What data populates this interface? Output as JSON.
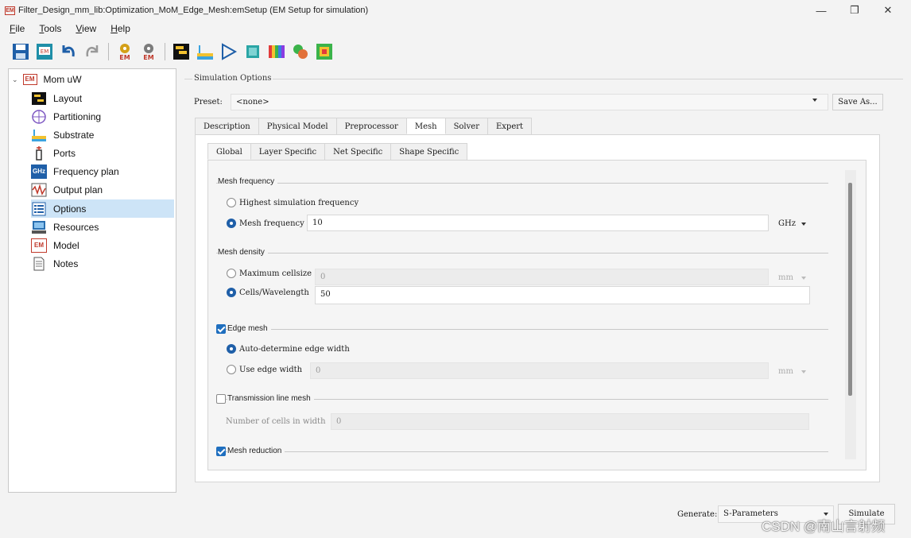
{
  "window": {
    "app_icon": "EM",
    "title": "Filter_Design_mm_lib:Optimization_MoM_Edge_Mesh:emSetup (EM Setup for simulation)",
    "controls": [
      "—",
      "❐",
      "✕"
    ]
  },
  "menu": [
    "File",
    "Tools",
    "View",
    "Help"
  ],
  "toolbar": {
    "icons": [
      "save-icon",
      "em-save-icon",
      "undo-icon",
      "redo-icon",
      "em-settings-icon",
      "em-settings-alt-icon",
      "layout-icon",
      "substrate-icon",
      "port-icon",
      "model-icon",
      "rainbow-icon",
      "component-icon",
      "mesh-plot-icon"
    ]
  },
  "tree": {
    "root": {
      "label": "Mom uW",
      "icon": "EM"
    },
    "items": [
      {
        "label": "Layout",
        "icon": "layout-icon"
      },
      {
        "label": "Partitioning",
        "icon": "partitioning-icon"
      },
      {
        "label": "Substrate",
        "icon": "substrate-icon"
      },
      {
        "label": "Ports",
        "icon": "ports-icon"
      },
      {
        "label": "Frequency plan",
        "icon": "ghz-icon",
        "icon_text": "GHz"
      },
      {
        "label": "Output plan",
        "icon": "output-plan-icon"
      },
      {
        "label": "Options",
        "icon": "options-icon",
        "selected": true
      },
      {
        "label": "Resources",
        "icon": "resources-icon"
      },
      {
        "label": "Model",
        "icon": "model-icon",
        "icon_text": "EM"
      },
      {
        "label": "Notes",
        "icon": "notes-icon"
      }
    ]
  },
  "simulation_options": {
    "group_title": "Simulation Options",
    "preset_label": "Preset:",
    "preset_value": "<none>",
    "save_as_label": "Save As...",
    "tabs": [
      "Description",
      "Physical Model",
      "Preprocessor",
      "Mesh",
      "Solver",
      "Expert"
    ],
    "active_tab": "Mesh",
    "subtabs": [
      "Global",
      "Layer Specific",
      "Net Specific",
      "Shape Specific"
    ],
    "active_subtab": "Global"
  },
  "mesh": {
    "frequency_section": "Mesh frequency",
    "opt_highest": "Highest simulation frequency",
    "opt_mesh_freq": "Mesh frequency",
    "mesh_freq_value": "10",
    "mesh_freq_unit": "GHz",
    "density_section": "Mesh density",
    "opt_max_cell": "Maximum cellsize",
    "max_cell_value": "0",
    "max_cell_unit": "mm",
    "opt_cells_wl": "Cells/Wavelength",
    "cells_wl_value": "50",
    "edge_mesh_label": "Edge mesh",
    "edge_mesh_checked": true,
    "opt_auto_edge": "Auto-determine edge width",
    "opt_use_edge": "Use edge width",
    "edge_width_value": "0",
    "edge_width_unit": "mm",
    "tline_label": "Transmission line mesh",
    "tline_checked": false,
    "cells_in_width_label": "Number of cells in width",
    "cells_in_width_value": "0",
    "reduction_label": "Mesh reduction",
    "reduction_checked": true
  },
  "bottom": {
    "generate_label": "Generate:",
    "generate_value": "S-Parameters",
    "simulate_label": "Simulate",
    "watermark": "CSDN @南山言射频"
  },
  "colors": {
    "accent": "#1f5fa8",
    "selection": "#cde4f7",
    "em_red": "#c0392b"
  }
}
